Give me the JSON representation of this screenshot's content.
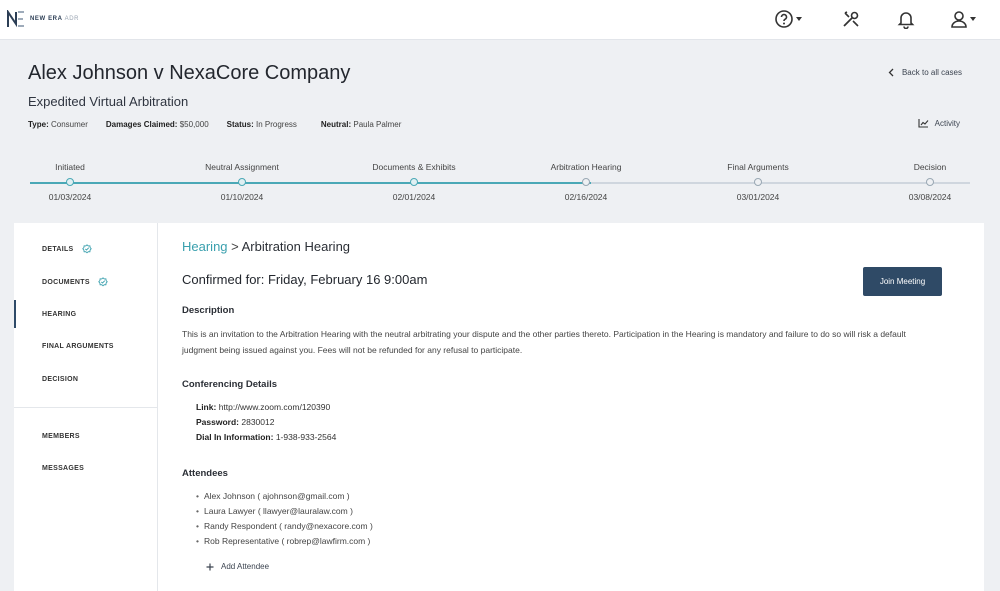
{
  "brand": {
    "name": "NEW ERA",
    "suffix": "ADR"
  },
  "topbar": {
    "icons": [
      "help-icon",
      "tools-icon",
      "bell-icon",
      "user-icon"
    ]
  },
  "case": {
    "title": "Alex Johnson v NexaCore Company",
    "subtitle": "Expedited Virtual Arbitration",
    "meta": [
      {
        "label": "Type:",
        "value": "Consumer"
      },
      {
        "label": "Damages Claimed:",
        "value": "$50,000"
      },
      {
        "label": "Status:",
        "value": "In Progress"
      },
      {
        "label": "Neutral:",
        "value": "Paula Palmer"
      }
    ],
    "back_label": "Back to all cases",
    "activity_label": "Activity"
  },
  "stepper": {
    "progress": 0.597,
    "steps": [
      {
        "name": "Initiated",
        "date": "01/03/2024",
        "done": true
      },
      {
        "name": "Neutral Assignment",
        "date": "01/10/2024",
        "done": true
      },
      {
        "name": "Documents & Exhibits",
        "date": "02/01/2024",
        "done": true
      },
      {
        "name": "Arbitration Hearing",
        "date": "02/16/2024",
        "done": false
      },
      {
        "name": "Final Arguments",
        "date": "03/01/2024",
        "done": false
      },
      {
        "name": "Decision",
        "date": "03/08/2024",
        "done": false
      }
    ]
  },
  "sidebar": {
    "items": [
      {
        "label": "DETAILS",
        "check": true
      },
      {
        "label": "DOCUMENTS",
        "check": true
      },
      {
        "label": "HEARING",
        "active": true
      },
      {
        "label": "FINAL ARGUMENTS"
      },
      {
        "label": "DECISION"
      }
    ],
    "secondary": [
      {
        "label": "MEMBERS"
      },
      {
        "label": "MESSAGES"
      }
    ]
  },
  "hearing": {
    "crumb_link": "Hearing",
    "crumb_sep": " > ",
    "crumb_current": "Arbitration Hearing",
    "confirmed": "Confirmed for: Friday, February 16 9:00am",
    "join_label": "Join Meeting",
    "description_heading": "Description",
    "description": "This is an invitation to the Arbitration Hearing with the neutral arbitrating your dispute and the other parties thereto. Participation in the Hearing is mandatory and failure to do so will risk a default judgment being issued against you. Fees will not be refunded for any refusal to participate.",
    "conf_heading": "Conferencing Details",
    "conf": [
      {
        "label": "Link:",
        "value": "http://www.zoom.com/120390"
      },
      {
        "label": "Password:",
        "value": "2830012"
      },
      {
        "label": "Dial In Information:",
        "value": "1-938-933-2564"
      }
    ],
    "attendees_heading": "Attendees",
    "attendees": [
      "Alex Johnson ( ajohnson@gmail.com )",
      "Laura Lawyer ( llawyer@lauralaw.com )",
      "Randy Respondent ( randy@nexacore.com )",
      "Rob Representative ( robrep@lawfirm.com )"
    ],
    "add_attendee": "Add Attendee"
  }
}
